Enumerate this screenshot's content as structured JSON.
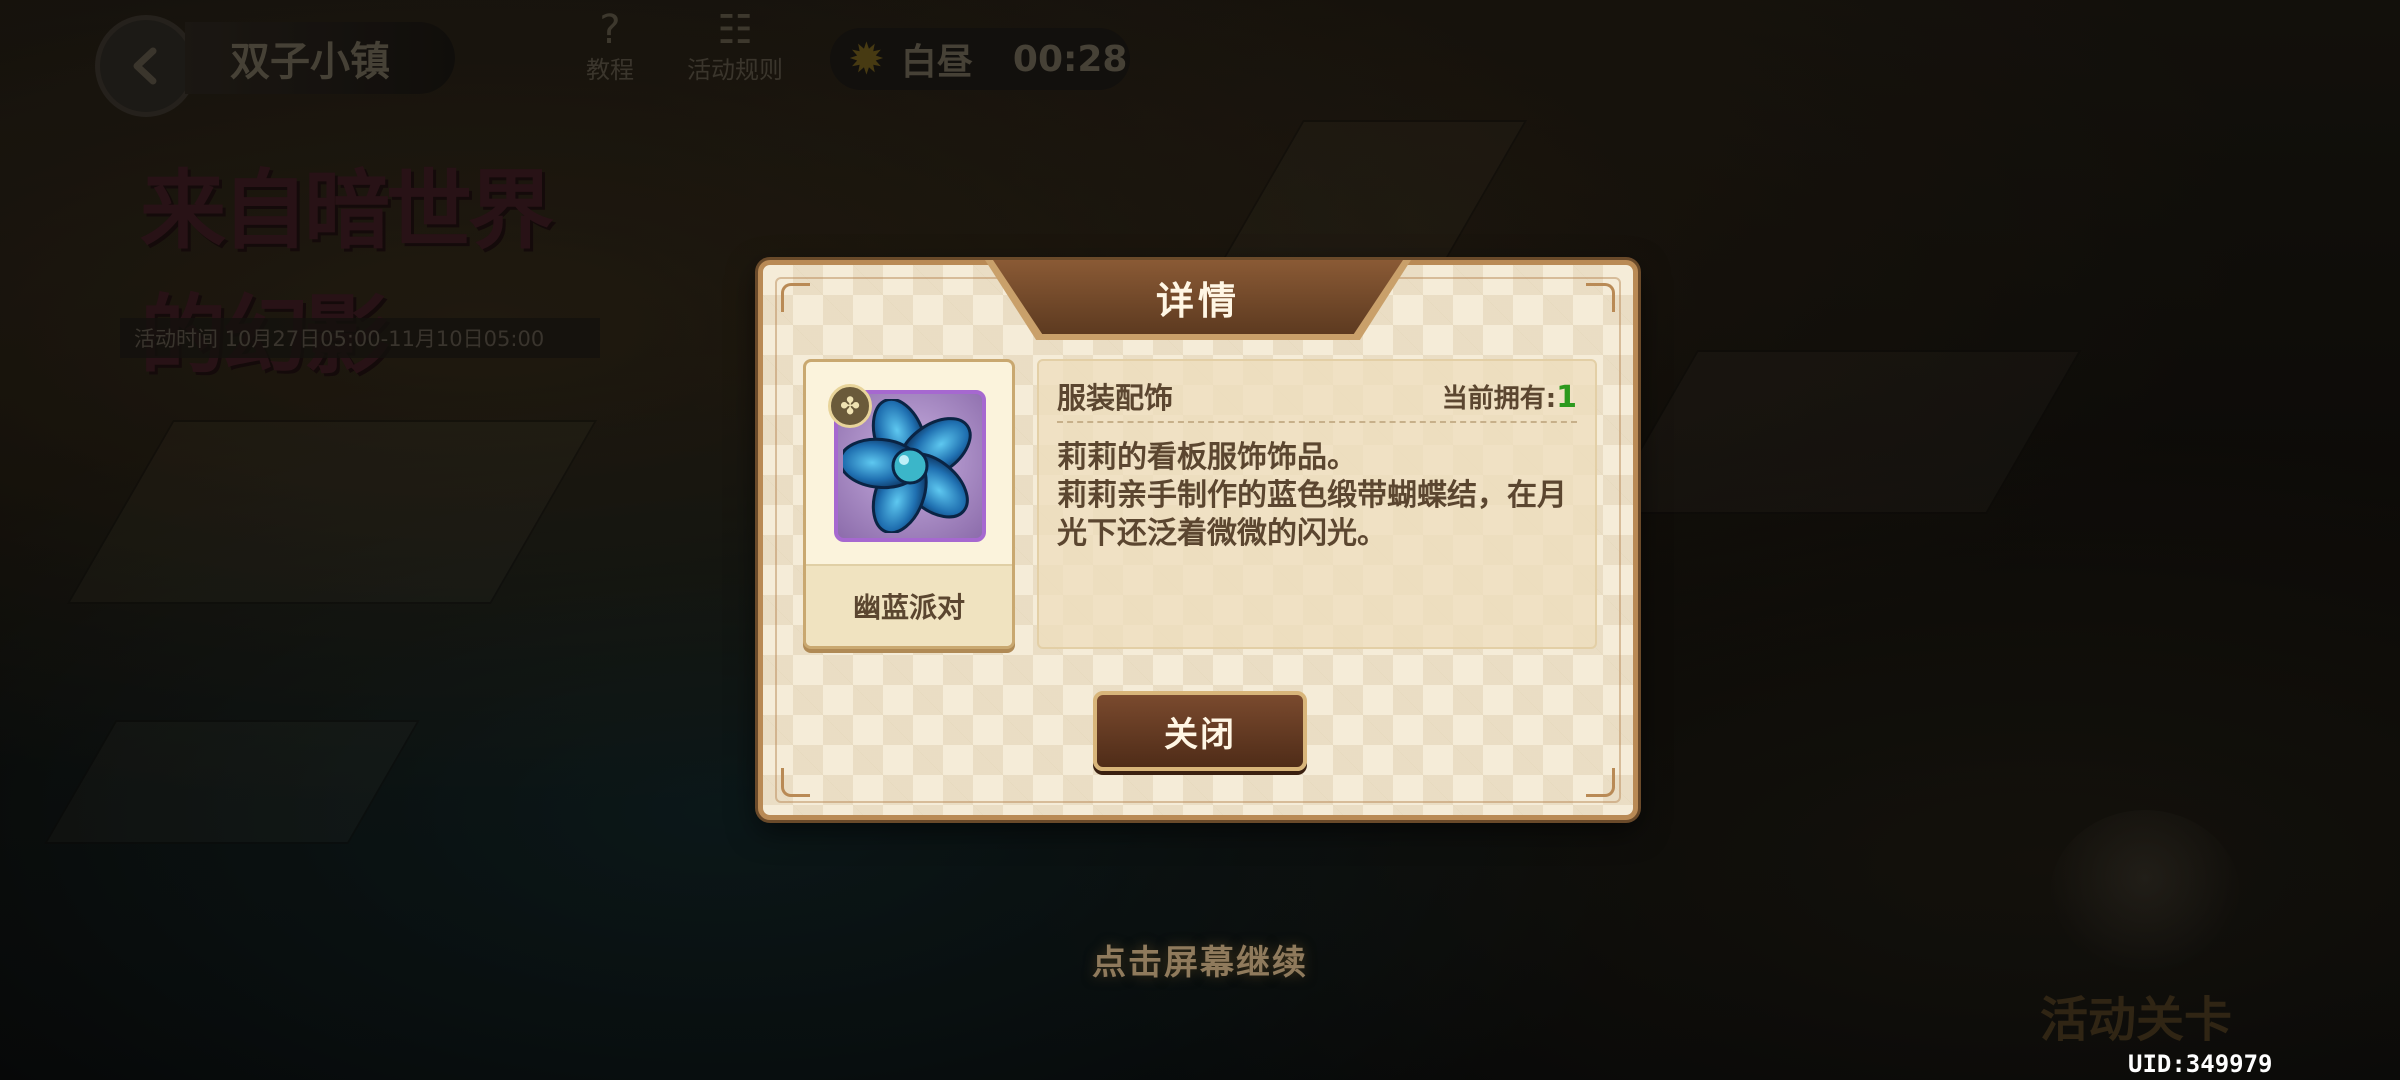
{
  "hud": {
    "town_title": "双子小镇",
    "tutorial_label": "教程",
    "rules_label": "活动规则",
    "daytime_label": "白昼",
    "clock": "00:28"
  },
  "event": {
    "banner_title": "来自暗世界的幻影",
    "time_text": "活动时间 10月27日05:00-11月10日05:00"
  },
  "dialog": {
    "title": "详情",
    "item": {
      "name": "幽蓝派对",
      "category": "服装配饰",
      "owned_label": "当前拥有:",
      "owned_count": "1",
      "description": "莉莉的看板服饰饰品。\n莉莉亲手制作的蓝色缎带蝴蝶结，在月光下还泛着微微的闪光。",
      "frame_color": "#a668d0",
      "icon": "blue-ribbon-bow-icon"
    },
    "close_label": "关闭"
  },
  "continue_hint": "点击屏幕继续",
  "mascot_label": "活动关卡",
  "uid": "UID:349979"
}
